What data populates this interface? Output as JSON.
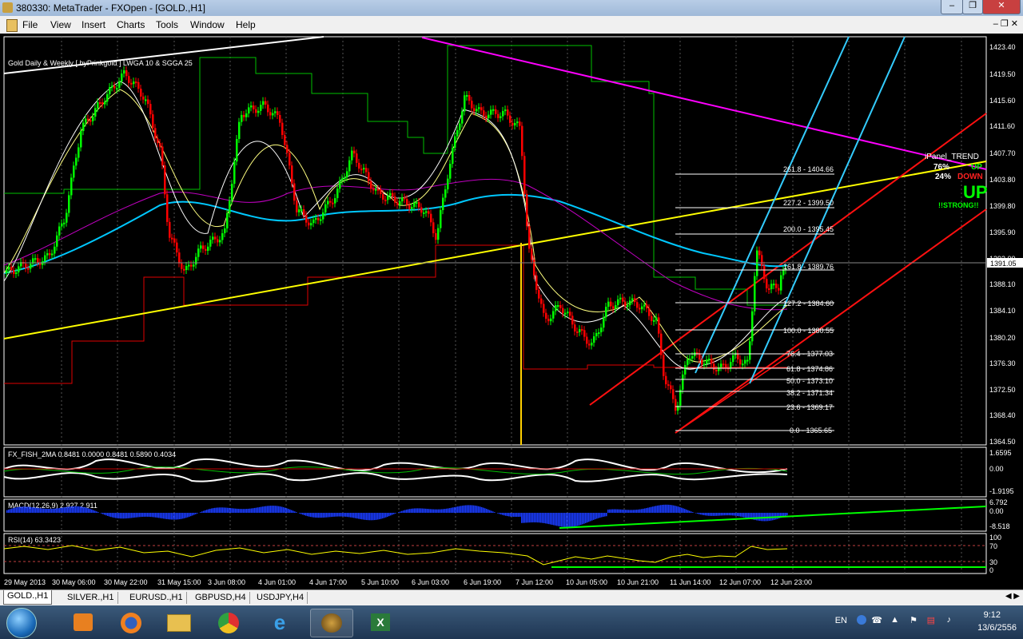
{
  "window": {
    "title": "380330: MetaTrader - FXOpen - [GOLD.,H1]"
  },
  "menu": [
    "File",
    "View",
    "Insert",
    "Charts",
    "Tools",
    "Window",
    "Help"
  ],
  "chart": {
    "label": "Gold Daily & Weekly [ byPrinkgold ] LWGA 10 & SGGA 25",
    "price_scale": [
      "1423.40",
      "1419.50",
      "1415.60",
      "1411.60",
      "1407.70",
      "1403.80",
      "1399.80",
      "1395.90",
      "1392.00",
      "1388.10",
      "1384.10",
      "1380.20",
      "1376.30",
      "1372.50",
      "1368.40",
      "1364.50"
    ],
    "current_price": "1391.05",
    "fib_levels": [
      "261.8 - 1404.66",
      "227.2 - 1399.50",
      "200.0 - 1395.45",
      "161.8 - 1389.76",
      "127.2 - 1384.60",
      "100.0 - 1380.55",
      "76.4 - 1377.03",
      "61.8 - 1374.86",
      "50.0 - 1373.10",
      "38.2 - 1371.34",
      "23.6 - 1369.17",
      "0.0 - 1365.65"
    ],
    "ipanel": {
      "title": "iPanel_TREND",
      "up_pct": "76%",
      "up_label": "UP",
      "down_pct": "24%",
      "down_label": "DOWN",
      "signal": "UP",
      "strength": "!!STRONG!!"
    },
    "fish_label": "FX_FISH_2MA 0.8481 0.0000 0.8481 0.5890 0.4034",
    "fish_scale": [
      "1.6595",
      "0.00",
      "-1.9195"
    ],
    "macd_label": "MACD(12,26,9) 2.927 2.911",
    "macd_scale": [
      "6.792",
      "0.00",
      "-8.518"
    ],
    "rsi_label": "RSI(14) 63.3423",
    "rsi_scale": [
      "100",
      "70",
      "30",
      "0"
    ],
    "time_axis": [
      "29 May 2013",
      "30 May 06:00",
      "30 May 22:00",
      "31 May 15:00",
      "3 Jun 08:00",
      "4 Jun 01:00",
      "4 Jun 17:00",
      "5 Jun 10:00",
      "6 Jun 03:00",
      "6 Jun 19:00",
      "7 Jun 12:00",
      "10 Jun 05:00",
      "10 Jun 21:00",
      "11 Jun 14:00",
      "12 Jun 07:00",
      "12 Jun 23:00"
    ]
  },
  "tabs": [
    "GOLD.,H1",
    "SILVER.,H1",
    "EURUSD.,H1",
    "GBPUSD,H4",
    "USDJPY,H4"
  ],
  "taskbar": {
    "icons": [
      "start-orb",
      "media-player-icon",
      "firefox-icon",
      "explorer-icon",
      "chrome-icon",
      "internet-explorer-icon",
      "metatrader-icon",
      "excel-icon"
    ]
  },
  "tray": {
    "lang": "EN",
    "time": "9:12",
    "date": "13/6/2556"
  },
  "colors": {
    "bull": "#00ff00",
    "bear": "#ff0000",
    "trendline": "#ffff00",
    "channel": "#ff0000",
    "blue_channel": "#33ccff",
    "magenta": "#ff00ff",
    "ma_cyan": "#00c8ff"
  }
}
